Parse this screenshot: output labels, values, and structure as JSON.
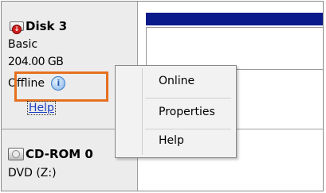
{
  "disk": {
    "icon": "disk-offline-icon",
    "name": "Disk 3",
    "type": "Basic",
    "size": "204.00 GB",
    "status": "Offline",
    "status_icon": "info-icon",
    "help_link": "Help"
  },
  "cdrom": {
    "icon": "cd-drive-icon",
    "name": "CD-ROM 0",
    "drive": "DVD (Z:)"
  },
  "context_menu": {
    "items": [
      "Online",
      "Properties",
      "Help"
    ]
  },
  "colors": {
    "highlight": "#e7701f",
    "partition_bar": "#0a1a8a",
    "link": "#1a3fbf"
  }
}
